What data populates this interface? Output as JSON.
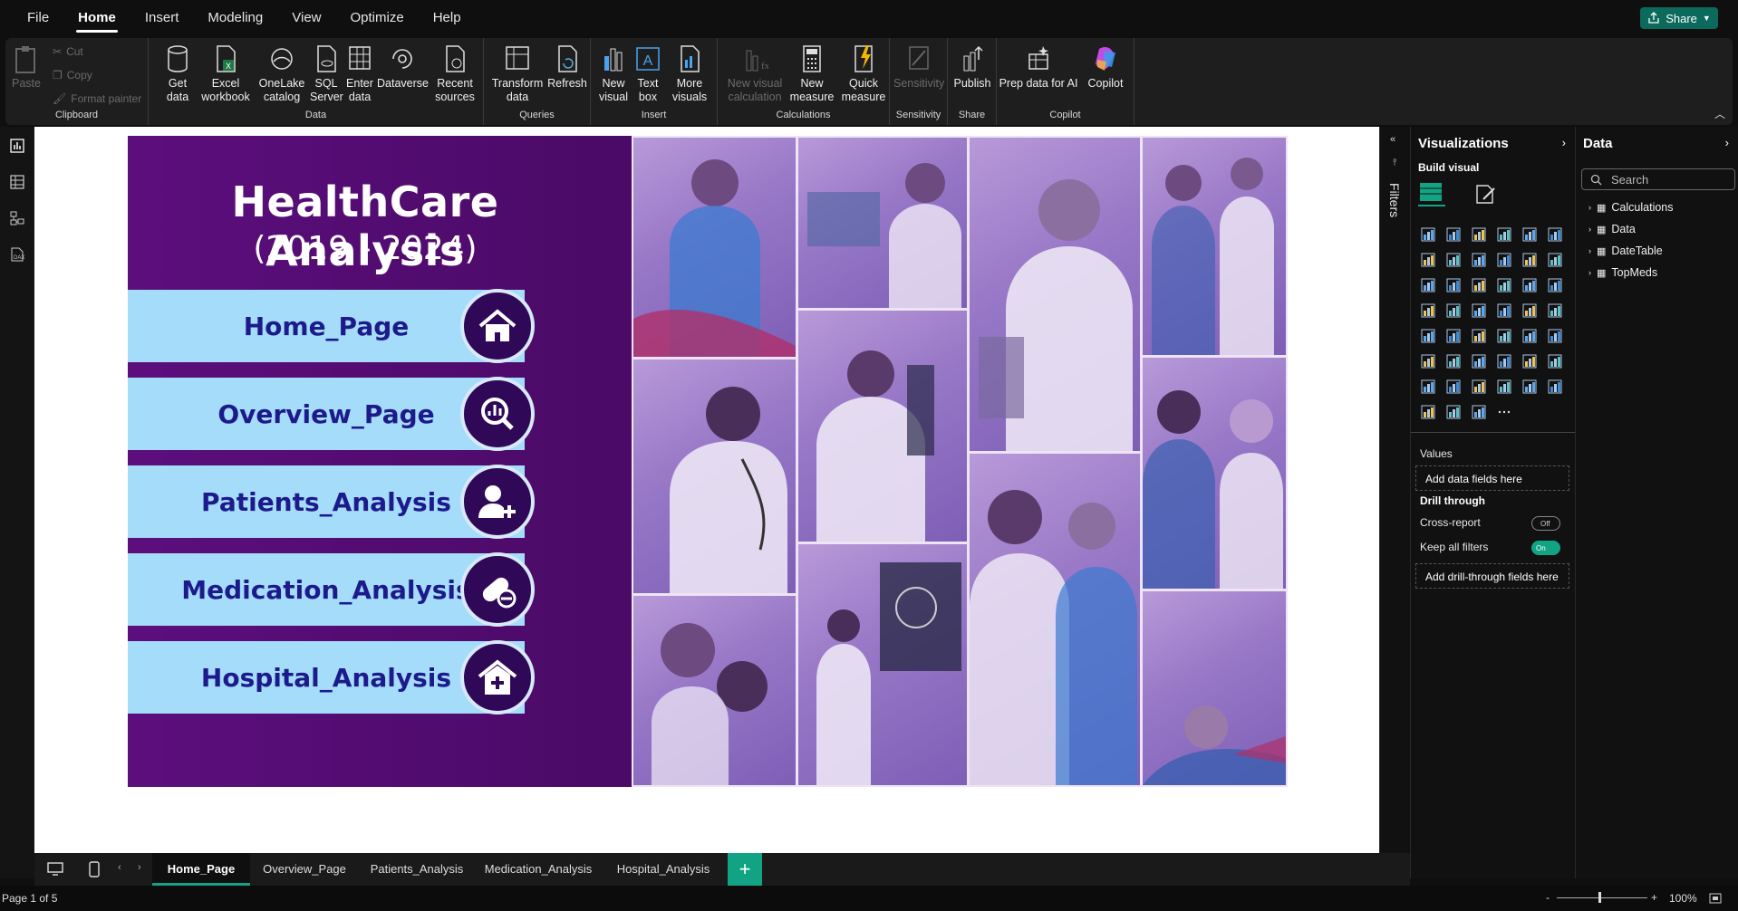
{
  "menu": {
    "items": [
      "File",
      "Home",
      "Insert",
      "Modeling",
      "View",
      "Optimize",
      "Help"
    ],
    "active": "Home",
    "share": "Share"
  },
  "ribbon": {
    "clipboard": {
      "label": "Clipboard",
      "paste": "Paste",
      "cut": "Cut",
      "copy": "Copy",
      "format_painter": "Format painter"
    },
    "data": {
      "label": "Data",
      "get_data": "Get data",
      "excel": "Excel workbook",
      "onelake": "OneLake catalog",
      "sql": "SQL Server",
      "enter": "Enter data",
      "dataverse": "Dataverse",
      "recent": "Recent sources"
    },
    "queries": {
      "label": "Queries",
      "transform": "Transform data",
      "refresh": "Refresh"
    },
    "insert": {
      "label": "Insert",
      "new_visual": "New visual",
      "text_box": "Text box",
      "more_visuals": "More visuals"
    },
    "calculations": {
      "label": "Calculations",
      "new_visual_calc": "New visual calculation",
      "new_measure": "New measure",
      "quick_measure": "Quick measure"
    },
    "sensitivity": {
      "label": "Sensitivity",
      "sensitivity": "Sensitivity"
    },
    "share": {
      "label": "Share",
      "publish": "Publish"
    },
    "copilot": {
      "label": "Copilot",
      "prep_data": "Prep data for AI",
      "copilot": "Copilot"
    }
  },
  "report": {
    "title": "HealthCare Analysis",
    "subtitle": "(2019 - 2024)",
    "nav": [
      "Home_Page",
      "Overview_Page",
      "Patients_Analysis",
      "Medication_Analysis",
      "Hospital_Analysis"
    ]
  },
  "filters_label": "Filters",
  "visualizations": {
    "title": "Visualizations",
    "build_visual": "Build visual",
    "values": "Values",
    "add_data": "Add data fields here",
    "drill_through": "Drill through",
    "cross_report": "Cross-report",
    "cross_report_state": "Off",
    "keep_all_filters": "Keep all filters",
    "keep_all_state": "On",
    "add_drill": "Add drill-through fields here",
    "more": "···"
  },
  "data_pane": {
    "title": "Data",
    "search_placeholder": "Search",
    "tables": [
      "Calculations",
      "Data",
      "DateTable",
      "TopMeds"
    ]
  },
  "tabs": {
    "pages": [
      "Home_Page",
      "Overview_Page",
      "Patients_Analysis",
      "Medication_Analysis",
      "Hospital_Analysis"
    ],
    "active": "Home_Page",
    "add": "+"
  },
  "status": {
    "page": "Page 1 of 5",
    "zoom": "100%",
    "minus": "-",
    "plus": "+"
  }
}
